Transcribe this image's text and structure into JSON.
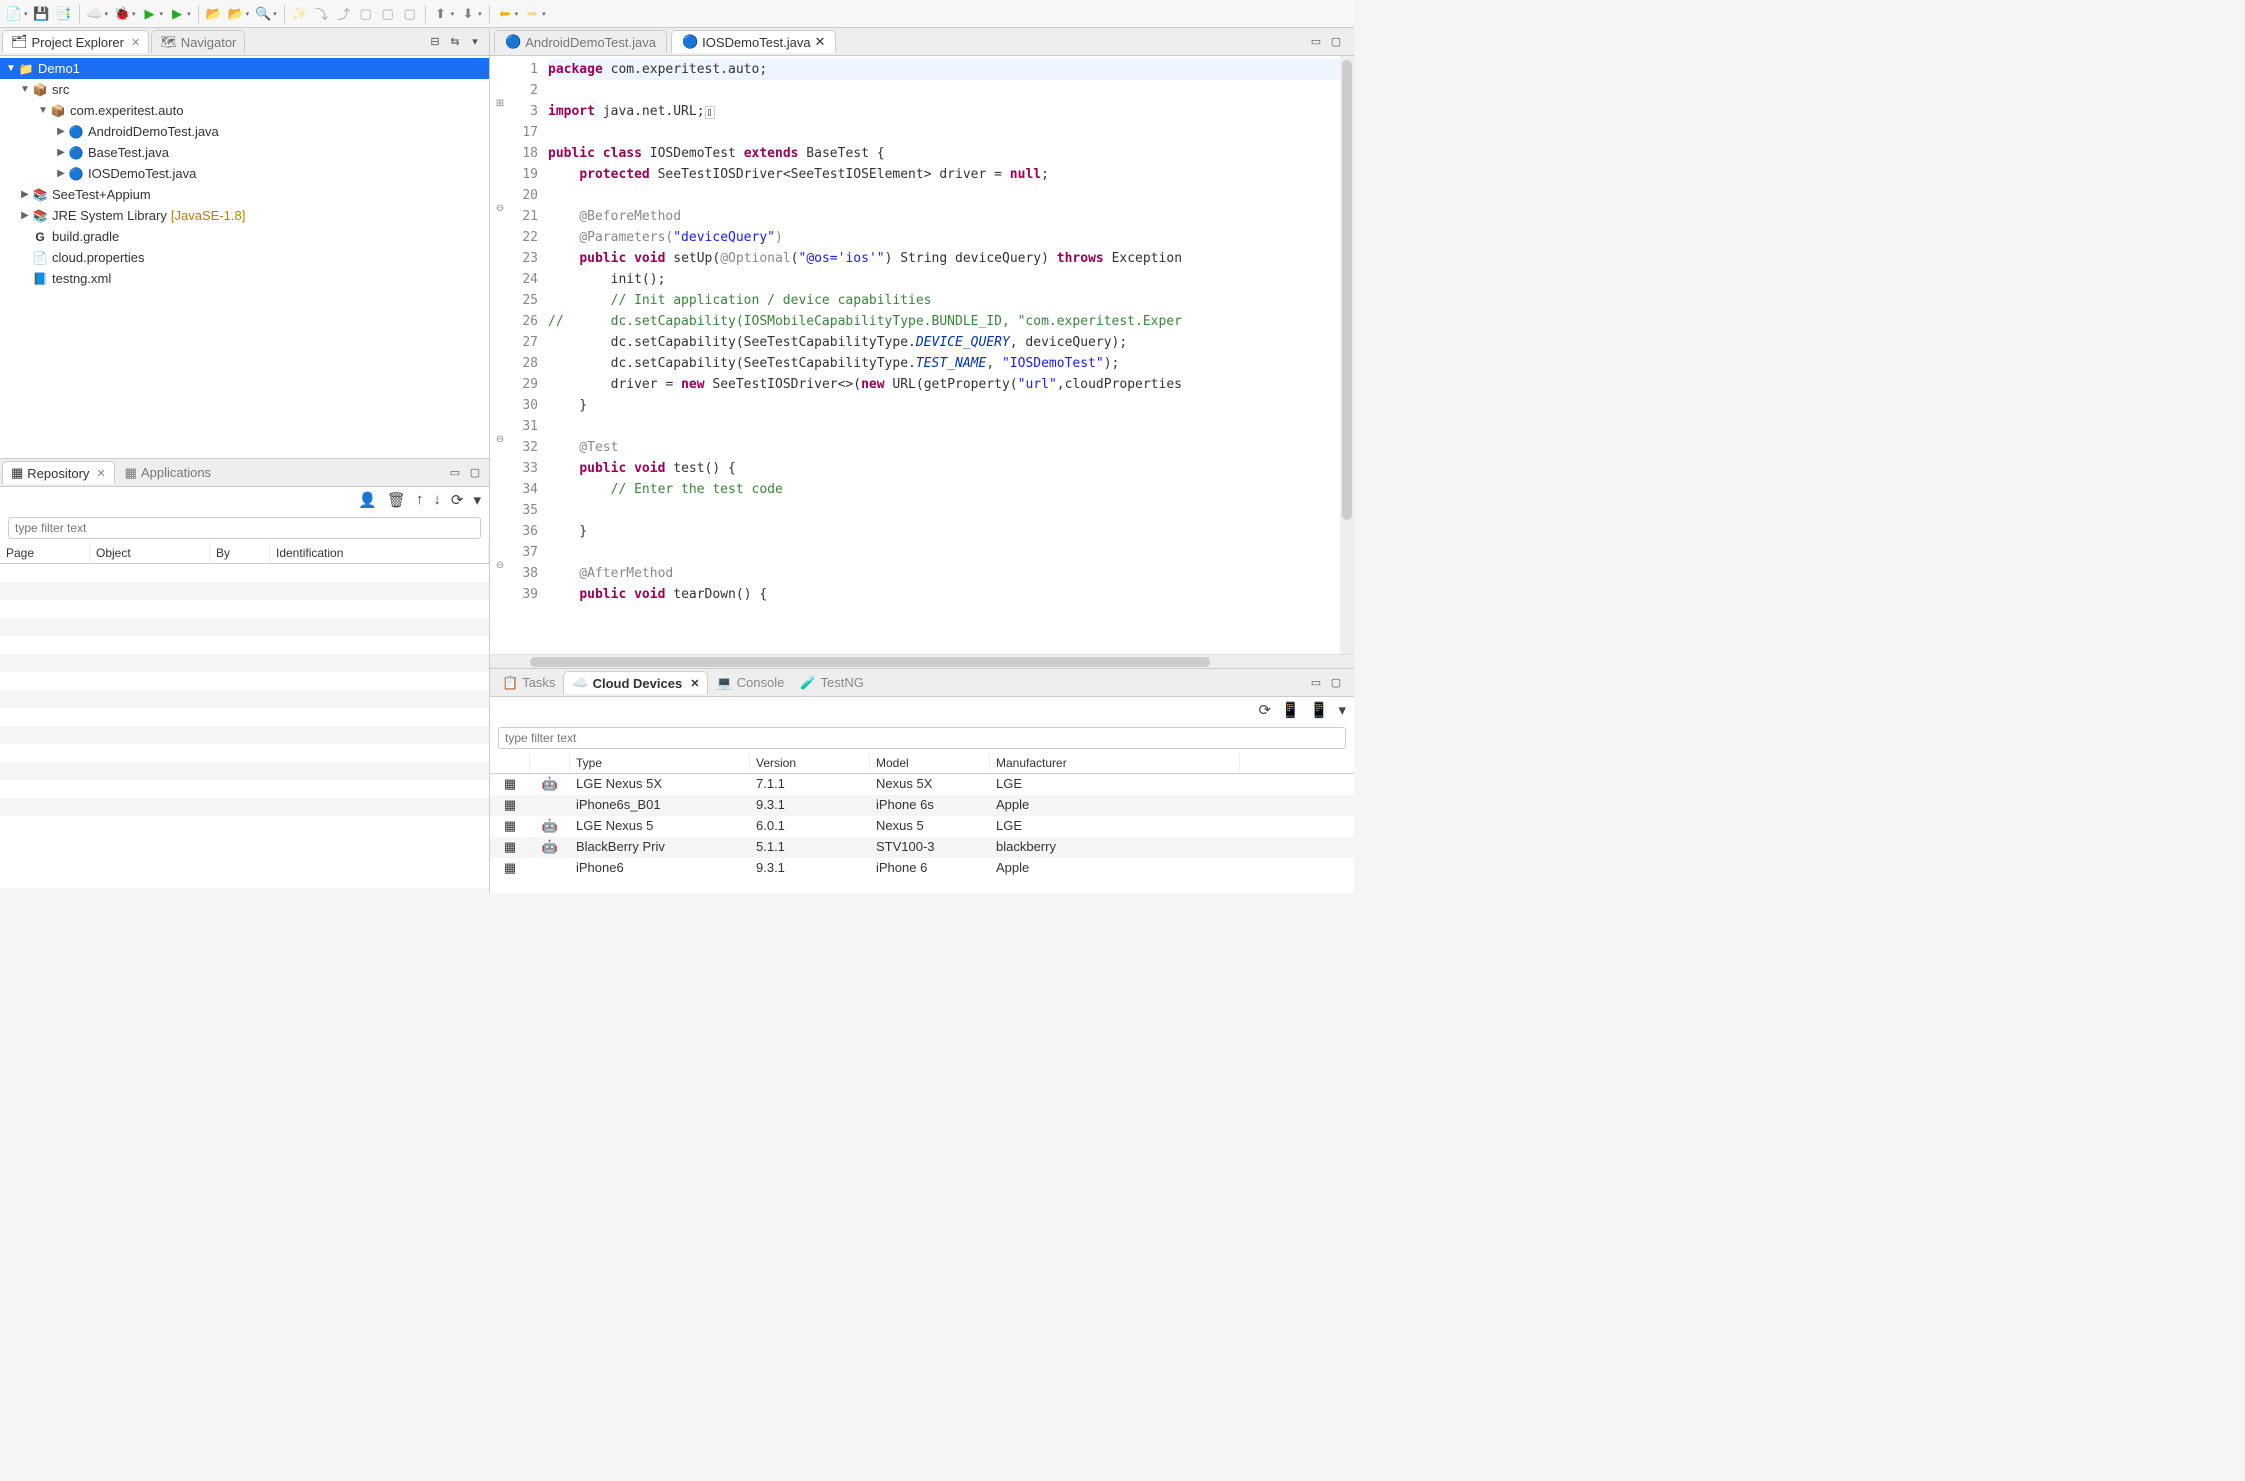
{
  "leftTabs": {
    "explorer": "Project Explorer",
    "navigator": "Navigator"
  },
  "project": {
    "name": "Demo1",
    "src": "src",
    "package": "com.experitest.auto",
    "files": [
      "AndroidDemoTest.java",
      "BaseTest.java",
      "IOSDemoTest.java"
    ],
    "seetest": "SeeTest+Appium",
    "jre": "JRE System Library",
    "jreSuffix": "[JavaSE-1.8]",
    "gradle": "build.gradle",
    "cloud": "cloud.properties",
    "testng": "testng.xml"
  },
  "repo": {
    "tab": "Repository",
    "appsTab": "Applications",
    "filterPlaceholder": "type filter text",
    "cols": [
      "Page",
      "Object",
      "By",
      "Identification"
    ]
  },
  "editor": {
    "tab1": "AndroidDemoTest.java",
    "tab2": "IOSDemoTest.java",
    "lineNums": [
      "1",
      "2",
      "3",
      "17",
      "18",
      "19",
      "20",
      "21",
      "22",
      "23",
      "24",
      "25",
      "26",
      "27",
      "28",
      "29",
      "30",
      "31",
      "32",
      "33",
      "34",
      "35",
      "36",
      "37",
      "38",
      "39"
    ],
    "gutterMarks": [
      "",
      "",
      "⊞",
      "",
      "",
      "",
      "",
      "⊖",
      "",
      "",
      "",
      "",
      "",
      "",
      "",
      "",
      "",
      "",
      "⊖",
      "",
      "",
      "",
      "",
      "",
      "⊖",
      ""
    ]
  },
  "code": {
    "l1_kw": "package",
    "l1_pkg": " com.experitest.auto;",
    "l3_kw": "import",
    "l3_pkg": " java.net.URL;",
    "l5_kw1": "public",
    "l5_kw2": "class",
    "l5_name": " IOSDemoTest ",
    "l5_kw3": "extends",
    "l5_base": " BaseTest {",
    "l6_kw": "protected",
    "l6_rest": " SeeTestIOSDriver<SeeTestIOSElement> driver = ",
    "l6_kw2": "null",
    "l6_semi": ";",
    "l8": "    @BeforeMethod",
    "l9_ann": "    @Parameters(",
    "l9_str": "\"deviceQuery\"",
    "l9_close": ")",
    "l10_kw1": "public",
    "l10_kw2": "void",
    "l10_name": " setUp(",
    "l10_ann": "@Optional",
    "l10_paren": "(",
    "l10_str": "\"@os='ios'\"",
    "l10_mid": ") String deviceQuery) ",
    "l10_kw3": "throws",
    "l10_end": " Exception",
    "l11": "        init();",
    "l12_c": "        // Init application / device capabilities",
    "l13_c": "//      dc.setCapability(IOSMobileCapabilityType.BUNDLE_ID, \"com.experitest.Exper",
    "l14_a": "        dc.setCapability(SeeTestCapabilityType.",
    "l14_f": "DEVICE_QUERY",
    "l14_b": ", deviceQuery);",
    "l15_a": "        dc.setCapability(SeeTestCapabilityType.",
    "l15_f": "TEST_NAME",
    "l15_b": ", ",
    "l15_s": "\"IOSDemoTest\"",
    "l15_c": ");",
    "l16_a": "        driver = ",
    "l16_kw": "new",
    "l16_b": " SeeTestIOSDriver<>(",
    "l16_kw2": "new",
    "l16_c": " URL(getProperty(",
    "l16_s": "\"url\"",
    "l16_d": ",cloudProperties",
    "l17": "    }",
    "l19": "    @Test",
    "l20_kw1": "public",
    "l20_kw2": "void",
    "l20_rest": " test() {",
    "l21_c": "        // Enter the test code",
    "l23": "    }",
    "l25": "    @AfterMethod",
    "l26_kw1": "public",
    "l26_kw2": "void",
    "l26_rest": " tearDown() {"
  },
  "bottom": {
    "tasks": "Tasks",
    "cloud": "Cloud Devices",
    "console": "Console",
    "testng": "TestNG",
    "filterPlaceholder": "type filter text",
    "cols": [
      "",
      "",
      "Type",
      "Version",
      "Model",
      "Manufacturer"
    ],
    "rows": [
      {
        "os": "android",
        "type": "LGE Nexus 5X",
        "ver": "7.1.1",
        "model": "Nexus 5X",
        "man": "LGE"
      },
      {
        "os": "ios",
        "type": "iPhone6s_B01",
        "ver": "9.3.1",
        "model": "iPhone 6s",
        "man": "Apple"
      },
      {
        "os": "android",
        "type": "LGE Nexus 5",
        "ver": "6.0.1",
        "model": "Nexus 5",
        "man": "LGE"
      },
      {
        "os": "android",
        "type": "BlackBerry Priv",
        "ver": "5.1.1",
        "model": "STV100-3",
        "man": "blackberry"
      },
      {
        "os": "ios",
        "type": "iPhone6",
        "ver": "9.3.1",
        "model": "iPhone 6",
        "man": "Apple"
      }
    ]
  }
}
